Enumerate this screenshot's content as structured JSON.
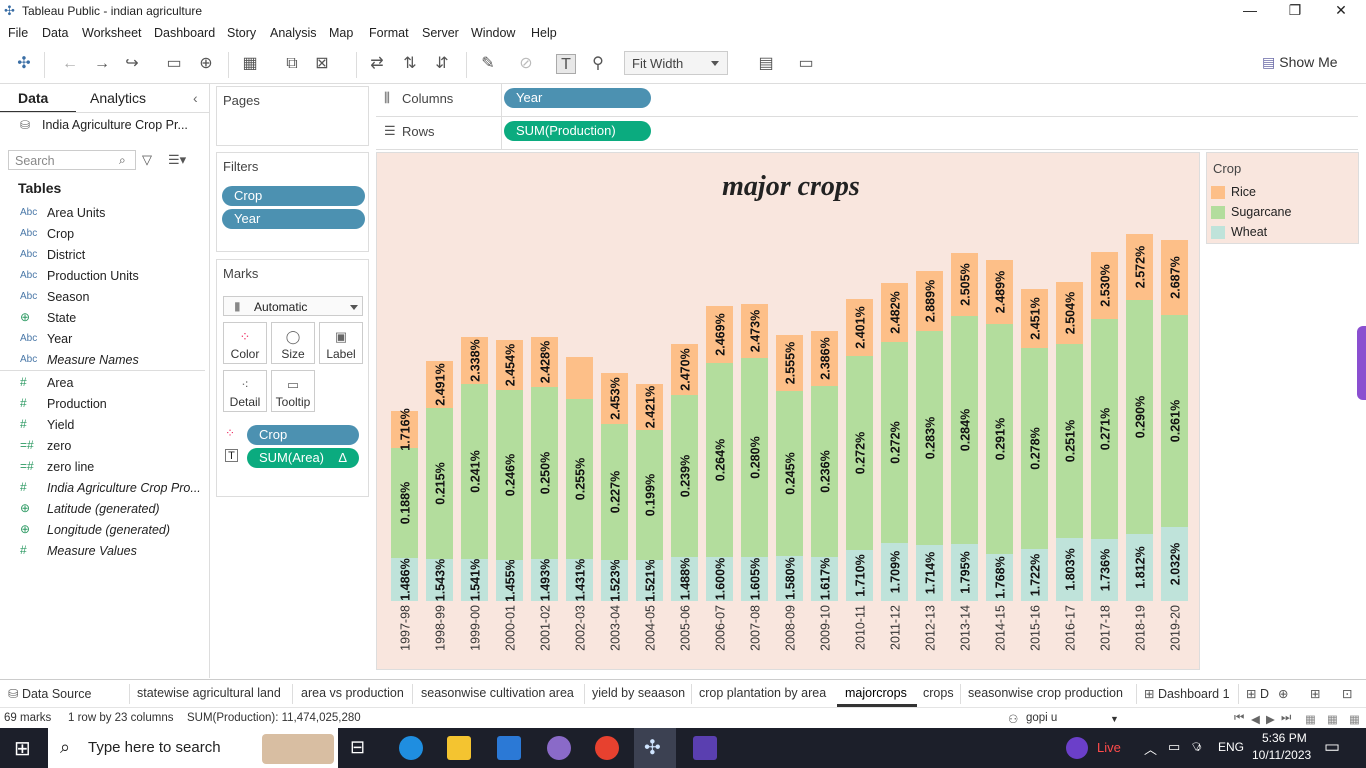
{
  "window": {
    "title": "Tableau Public - indian agriculture",
    "minimize": "—",
    "restore": "❐",
    "close": "✕"
  },
  "menu": [
    "File",
    "Data",
    "Worksheet",
    "Dashboard",
    "Story",
    "Analysis",
    "Map",
    "Format",
    "Server",
    "Window",
    "Help"
  ],
  "toolbar": {
    "fit": "Fit Width",
    "show_me": "Show Me"
  },
  "left": {
    "tab_data": "Data",
    "tab_analytics": "Analytics",
    "datasource": "India Agriculture Crop Pr...",
    "search_placeholder": "Search",
    "tables": "Tables",
    "dimensions": [
      {
        "name": "Area Units",
        "type": "Abc"
      },
      {
        "name": "Crop",
        "type": "Abc"
      },
      {
        "name": "District",
        "type": "Abc"
      },
      {
        "name": "Production Units",
        "type": "Abc"
      },
      {
        "name": "Season",
        "type": "Abc"
      },
      {
        "name": "State",
        "type": "geo"
      },
      {
        "name": "Year",
        "type": "Abc"
      },
      {
        "name": "Measure Names",
        "type": "Abc",
        "italic": true
      }
    ],
    "measures": [
      {
        "name": "Area",
        "type": "#"
      },
      {
        "name": "Production",
        "type": "#"
      },
      {
        "name": "Yield",
        "type": "#"
      },
      {
        "name": "zero",
        "type": "=#"
      },
      {
        "name": "zero line",
        "type": "=#"
      },
      {
        "name": "India Agriculture Crop Pro...",
        "type": "#",
        "italic": true
      },
      {
        "name": "Latitude (generated)",
        "type": "geo",
        "italic": true
      },
      {
        "name": "Longitude (generated)",
        "type": "geo",
        "italic": true
      },
      {
        "name": "Measure Values",
        "type": "#",
        "italic": true
      }
    ]
  },
  "cards": {
    "pages": "Pages",
    "filters": "Filters",
    "filter_pills": [
      "Crop",
      "Year"
    ],
    "marks": "Marks",
    "mark_type": "Automatic",
    "mark_buttons": [
      "Color",
      "Size",
      "Label",
      "Detail",
      "Tooltip"
    ],
    "mark_pills": [
      {
        "label": "Crop"
      },
      {
        "label": "SUM(Area)",
        "suffix": "Δ"
      }
    ]
  },
  "shelves": {
    "columns_label": "Columns",
    "columns_pill": "Year",
    "rows_label": "Rows",
    "rows_pill": "SUM(Production)"
  },
  "legend": {
    "title": "Crop",
    "items": [
      {
        "name": "Rice",
        "color": "#fdbf88"
      },
      {
        "name": "Sugarcane",
        "color": "#b3dd9d"
      },
      {
        "name": "Wheat",
        "color": "#bfe3da"
      }
    ]
  },
  "chart_data": {
    "type": "bar",
    "stacked": true,
    "title": "major crops",
    "categories": [
      "1997-98",
      "1998-99",
      "1999-00",
      "2000-01",
      "2001-02",
      "2002-03",
      "2003-04",
      "2004-05",
      "2005-06",
      "2006-07",
      "2007-08",
      "2008-09",
      "2009-10",
      "2010-11",
      "2011-12",
      "2012-13",
      "2013-14",
      "2014-15",
      "2015-16",
      "2016-17",
      "2017-18",
      "2018-19",
      "2019-20"
    ],
    "colors": {
      "Rice": "#fdbf88",
      "Sugarcane": "#b3dd9d",
      "Wheat": "#bfe3da"
    },
    "relative_heights": {
      "Wheat": [
        43,
        42,
        42,
        41,
        42,
        42,
        41,
        41,
        44,
        44,
        44,
        45,
        44,
        51,
        58,
        56,
        57,
        47,
        52,
        63,
        62,
        67,
        74
      ],
      "Sugarcane": [
        110,
        151,
        175,
        170,
        172,
        160,
        136,
        130,
        162,
        194,
        199,
        165,
        171,
        194,
        201,
        214,
        228,
        230,
        201,
        194,
        220,
        234,
        212
      ],
      "Rice": [
        37,
        47,
        47,
        50,
        50,
        42,
        51,
        46,
        51,
        57,
        54,
        56,
        55,
        57,
        59,
        60,
        63,
        64,
        59,
        62,
        67,
        66,
        75
      ]
    },
    "labels": {
      "Wheat": [
        "1.486%",
        "1.543%",
        "1.541%",
        "1.455%",
        "1.493%",
        "1.431%",
        "1.523%",
        "1.521%",
        "1.488%",
        "1.600%",
        "1.605%",
        "1.580%",
        "1.617%",
        "1.710%",
        "1.709%",
        "1.714%",
        "1.795%",
        "1.768%",
        "1.722%",
        "1.803%",
        "1.736%",
        "1.812%",
        "2.032%"
      ],
      "Sugarcane": [
        "0.188%",
        "0.215%",
        "0.241%",
        "0.246%",
        "0.250%",
        "0.255%",
        "0.227%",
        "0.199%",
        "0.239%",
        "0.264%",
        "0.280%",
        "0.245%",
        "0.236%",
        "0.272%",
        "0.272%",
        "0.283%",
        "0.284%",
        "0.291%",
        "0.278%",
        "0.251%",
        "0.271%",
        "0.290%",
        "0.261%"
      ],
      "Rice": [
        "1.716%",
        "2.491%",
        "2.338%",
        "2.454%",
        "2.428%",
        "",
        "2.453%",
        "2.421%",
        "2.470%",
        "2.469%",
        "2.473%",
        "2.555%",
        "2.386%",
        "2.401%",
        "2.482%",
        "2.889%",
        "2.505%",
        "2.489%",
        "2.451%",
        "2.504%",
        "2.530%",
        "2.572%",
        "2.687%"
      ]
    },
    "grid": false,
    "legend": "right"
  },
  "sheets": [
    "Data Source",
    "statewise agricultural land",
    "area vs production",
    "seasonwise cultivation area",
    "yield by seaason",
    "crop plantation by area",
    "majorcrops",
    "crops",
    "seasonwise crop production",
    "Dashboard 1",
    "D"
  ],
  "active_sheet": "majorcrops",
  "status": {
    "marks": "69 marks",
    "rows": "1 row by 23 columns",
    "sum": "SUM(Production): 11,474,025,280",
    "user": "gopi u"
  },
  "taskbar": {
    "search": "Type here to search",
    "live": "Live",
    "lang": "ENG",
    "time": "5:36 PM",
    "date": "10/11/2023"
  }
}
